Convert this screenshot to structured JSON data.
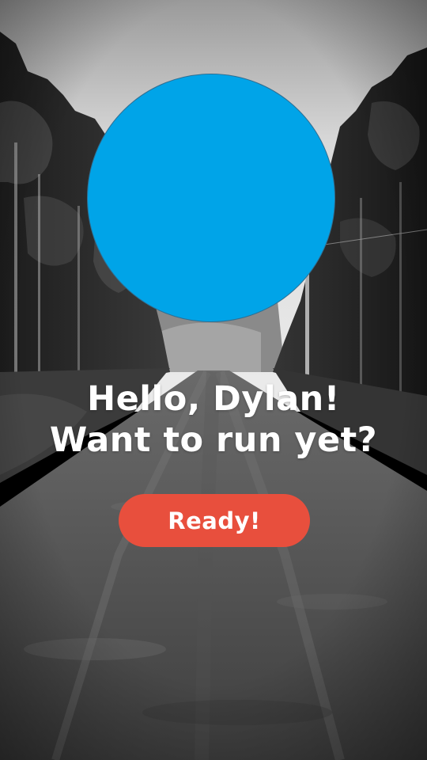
{
  "colors": {
    "avatar_fill": "#00A4E8",
    "button_fill": "#E84F3D",
    "text": "#FFFFFF"
  },
  "background": {
    "description_icon": "forest-road-photo"
  },
  "avatar": {
    "icon": "profile-avatar-icon"
  },
  "greeting": {
    "line1": "Hello, Dylan!",
    "line2": "Want to run yet?"
  },
  "ready_button": {
    "label": "Ready!"
  }
}
